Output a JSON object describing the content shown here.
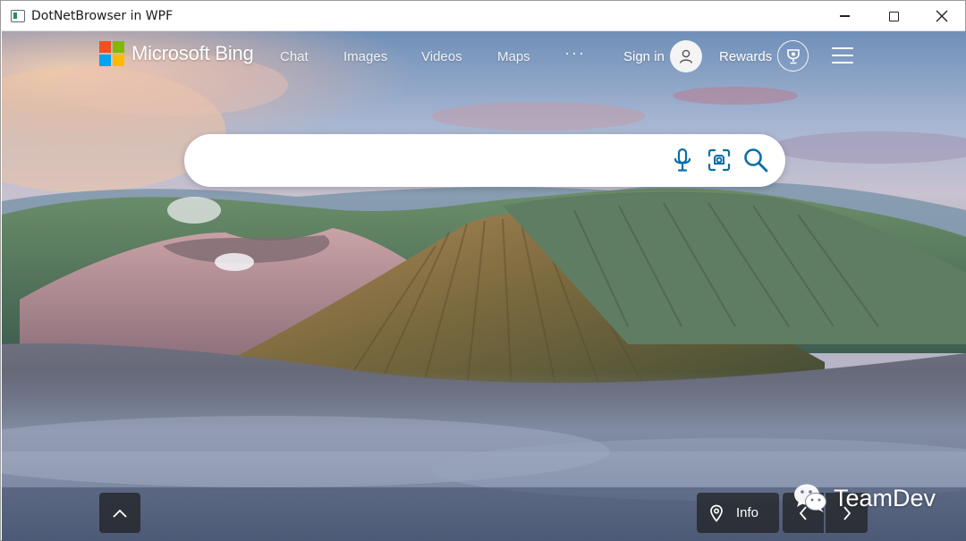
{
  "window": {
    "title": "DotNetBrowser in WPF",
    "controls": {
      "minimize": "minimize-icon",
      "maximize": "maximize-icon",
      "close": "close-icon"
    }
  },
  "header": {
    "brand": "Microsoft Bing",
    "nav": [
      {
        "label": "Chat"
      },
      {
        "label": "Images"
      },
      {
        "label": "Videos"
      },
      {
        "label": "Maps"
      }
    ],
    "more_label": "···",
    "sign_in": "Sign in",
    "rewards": "Rewards"
  },
  "search": {
    "value": "",
    "placeholder": "",
    "icons": [
      "microphone-icon",
      "visual-search-icon",
      "search-icon"
    ]
  },
  "footer": {
    "info_label": "Info",
    "icons": [
      "chevron-up-icon",
      "location-pin-icon",
      "chevron-left-icon",
      "chevron-right-icon"
    ]
  },
  "watermark": {
    "text": "TeamDev"
  },
  "colors": {
    "search_icon": "#0a6fa8",
    "ms_red": "#f25022",
    "ms_green": "#7fba00",
    "ms_blue": "#00a4ef",
    "ms_yellow": "#ffb900"
  }
}
